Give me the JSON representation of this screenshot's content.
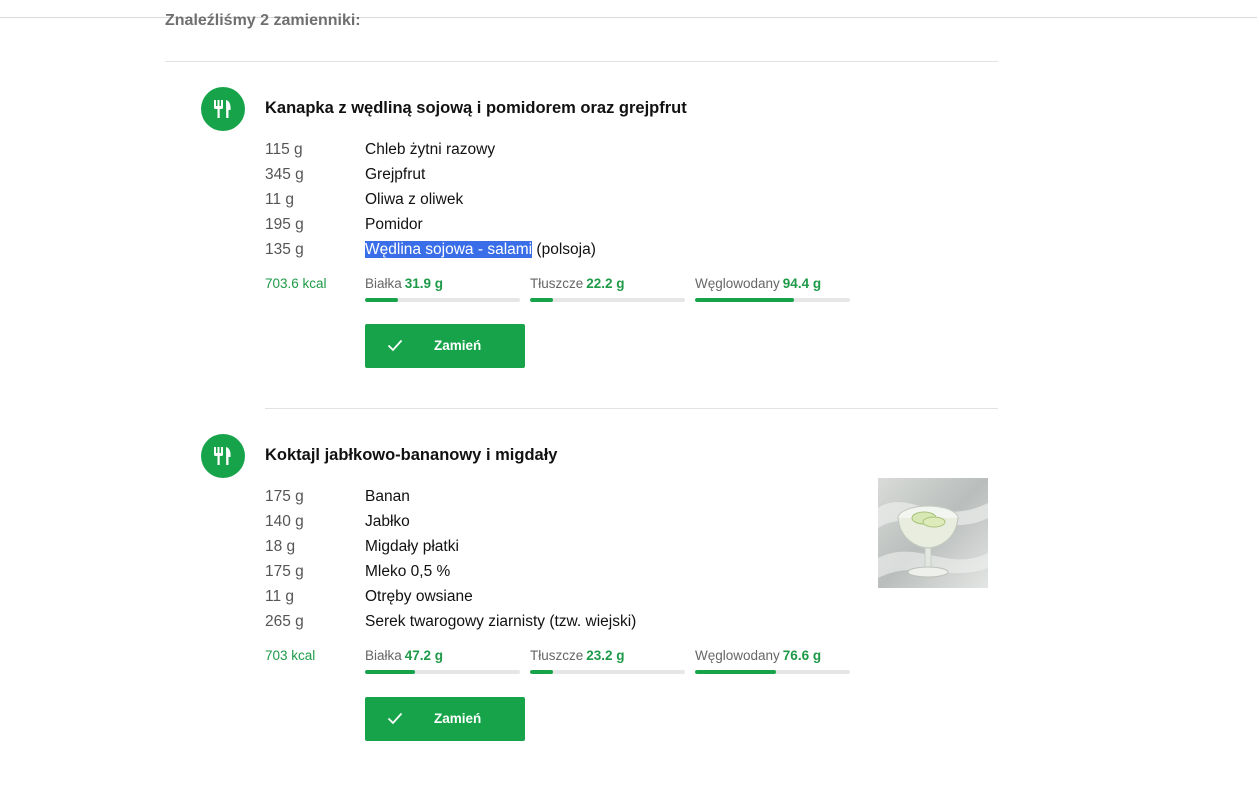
{
  "header": {
    "found_text": "Znaleźliśmy 2 zamienniki:"
  },
  "meals": [
    {
      "icon": "cutlery-icon",
      "title": "Kanapka z wędliną sojową i pomidorem oraz grejpfrut",
      "ingredients": [
        {
          "amount": "115 g",
          "name": "Chleb żytni razowy"
        },
        {
          "amount": "345 g",
          "name": "Grejpfrut"
        },
        {
          "amount": "11 g",
          "name": "Oliwa z oliwek"
        },
        {
          "amount": "195 g",
          "name": "Pomidor"
        },
        {
          "amount": "135 g",
          "name": "Wędlina sojowa - salami (polsoja)",
          "selected_text": "Wędlina sojowa - salami",
          "rest_text": " (polsoja)"
        }
      ],
      "kcal": "703.6 kcal",
      "macros": [
        {
          "label": "Białka",
          "value": "31.9 g",
          "fill": 0.21
        },
        {
          "label": "Tłuszcze",
          "value": "22.2 g",
          "fill": 0.15
        },
        {
          "label": "Węglowodany",
          "value": "94.4 g",
          "fill": 0.64
        }
      ],
      "button_label": "Zamień"
    },
    {
      "icon": "cutlery-icon",
      "title": "Koktajl jabłkowo-bananowy i migdały",
      "ingredients": [
        {
          "amount": "175 g",
          "name": "Banan"
        },
        {
          "amount": "140 g",
          "name": "Jabłko"
        },
        {
          "amount": "18 g",
          "name": "Migdały płatki"
        },
        {
          "amount": "175 g",
          "name": "Mleko 0,5 %"
        },
        {
          "amount": "11 g",
          "name": "Otręby owsiane"
        },
        {
          "amount": "265 g",
          "name": "Serek twarogowy ziarnisty (tzw. wiejski)"
        }
      ],
      "kcal": "703 kcal",
      "macros": [
        {
          "label": "Białka",
          "value": "47.2 g",
          "fill": 0.32
        },
        {
          "label": "Tłuszcze",
          "value": "23.2 g",
          "fill": 0.15
        },
        {
          "label": "Węglowodany",
          "value": "76.6 g",
          "fill": 0.52
        }
      ],
      "button_label": "Zamień",
      "photo": "smoothie-glass-photo"
    }
  ],
  "colors": {
    "accent": "#17a34a",
    "accent_text": "#1e9a48",
    "selection": "#3a6ee8",
    "track": "#e6e6e6"
  }
}
